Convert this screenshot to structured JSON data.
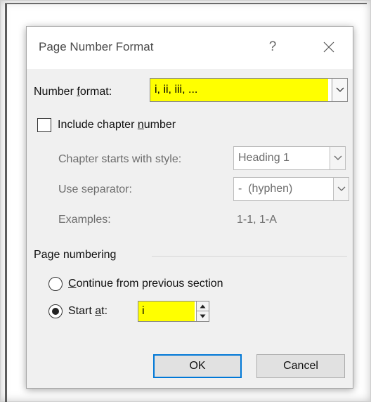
{
  "colors": {
    "highlight": "#ffff00",
    "accent": "#0078d7",
    "disabled_text": "#6d6d6d"
  },
  "dialog": {
    "title": "Page Number Format",
    "help": "?",
    "icons": {
      "close": "close-icon",
      "dropdown": "chevron-down-icon",
      "spin_up": "triangle-up-icon",
      "spin_down": "triangle-down-icon"
    }
  },
  "number_format": {
    "label_pre": "Number ",
    "label_u": "f",
    "label_post": "ormat:",
    "value": "i, ii, iii, ..."
  },
  "include_chapter": {
    "label_pre": "Include chapter ",
    "label_u": "n",
    "label_post": "umber",
    "checked": false
  },
  "chapter": {
    "style_label": "Chapter starts with style:",
    "style_value": "Heading 1",
    "separator_label": "Use separator:",
    "separator_value": "-  (hyphen)",
    "examples_label": "Examples:",
    "examples_value": "1-1, 1-A"
  },
  "page_numbering": {
    "heading": "Page numbering",
    "continue_u": "C",
    "continue_rest": "ontinue from previous section",
    "start_pre": "Start ",
    "start_u": "a",
    "start_post": "t:",
    "start_value": "i",
    "selected": "start_at"
  },
  "buttons": {
    "ok": "OK",
    "cancel": "Cancel"
  }
}
